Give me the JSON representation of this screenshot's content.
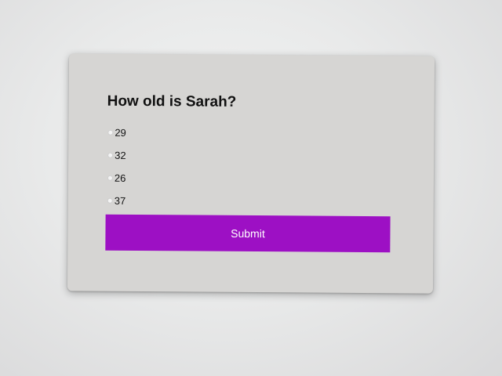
{
  "quiz": {
    "question": "How old is Sarah?",
    "options": [
      {
        "label": "29"
      },
      {
        "label": "32"
      },
      {
        "label": "26"
      },
      {
        "label": "37"
      }
    ],
    "submit_label": "Submit"
  },
  "colors": {
    "submit_background": "#9d10c4",
    "card_background": "#d6d5d3"
  }
}
